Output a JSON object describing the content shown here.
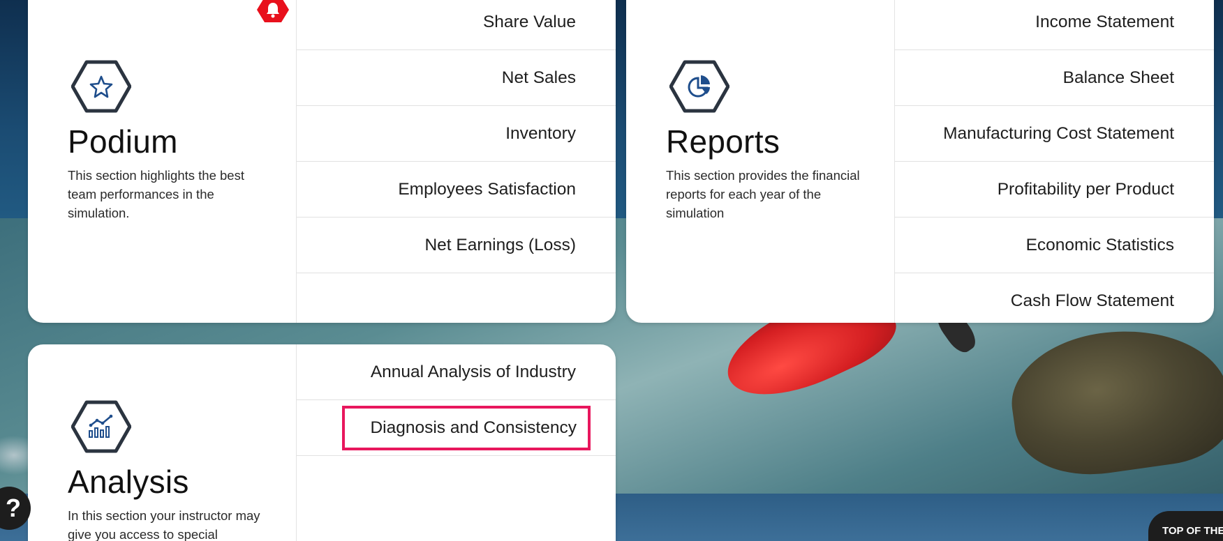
{
  "podium": {
    "title": "Podium",
    "description": "This section highlights the best team performances in the simulation.",
    "items": [
      {
        "label": "Share Value"
      },
      {
        "label": "Net Sales"
      },
      {
        "label": "Inventory"
      },
      {
        "label": "Employees Satisfaction"
      },
      {
        "label": "Net Earnings (Loss)"
      }
    ]
  },
  "reports": {
    "title": "Reports",
    "description": "This section provides the financial reports for each year of the simulation",
    "items": [
      {
        "label": "Income Statement"
      },
      {
        "label": "Balance Sheet"
      },
      {
        "label": "Manufacturing Cost Statement"
      },
      {
        "label": "Profitability per Product"
      },
      {
        "label": "Economic Statistics"
      },
      {
        "label": "Cash Flow Statement"
      }
    ]
  },
  "analysis": {
    "title": "Analysis",
    "description": "In this section your instructor may give you access to special",
    "items": [
      {
        "label": "Annual Analysis of Industry"
      },
      {
        "label": "Diagnosis and Consistency"
      }
    ]
  },
  "help": {
    "label": "?"
  },
  "top_button": {
    "label": "TOP OF THE PAGE"
  },
  "colors": {
    "accent_highlight": "#e8175d",
    "notification": "#e8101c",
    "icon_blue": "#1f4e8c",
    "hex_outline": "#2b3440"
  },
  "icons": {
    "podium": "star-icon",
    "reports": "pie-chart-icon",
    "analysis": "bar-chart-trend-icon",
    "notification": "bell-icon"
  }
}
